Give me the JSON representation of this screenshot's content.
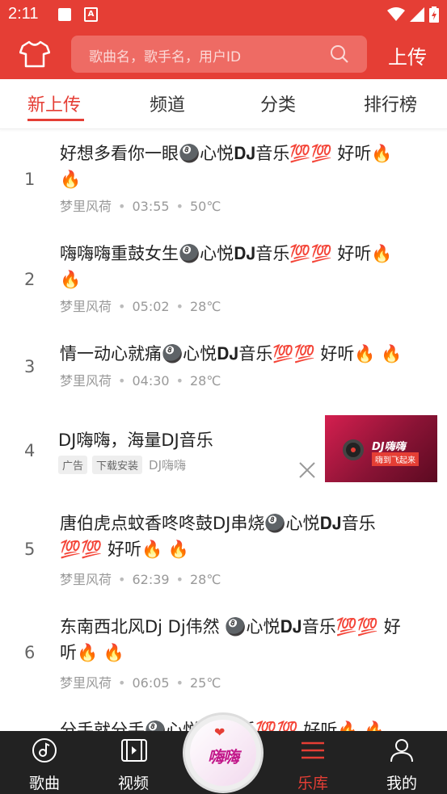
{
  "status_bar": {
    "time": "2:11",
    "icon_a": "A"
  },
  "header": {
    "search_placeholder": "歌曲名，歌手名，用户ID",
    "upload_label": "上传",
    "icons": [
      "shirt-icon",
      "search-icon"
    ]
  },
  "tabs": [
    {
      "label": "新上传",
      "active": true
    },
    {
      "label": "频道",
      "active": false
    },
    {
      "label": "分类",
      "active": false
    },
    {
      "label": "排行榜",
      "active": false
    }
  ],
  "songs": [
    {
      "index": "1",
      "title_line1": "好想多看你一眼🎱心悦𝐃𝐉音乐💯💯 好听🔥",
      "title_line2": "🔥",
      "artist": "梦里风荷",
      "duration": "03:55",
      "temp": "50℃"
    },
    {
      "index": "2",
      "title_line1": "嗨嗨嗨重鼓女生🎱心悦𝐃𝐉音乐💯💯 好听🔥",
      "title_line2": "🔥",
      "artist": "梦里风荷",
      "duration": "05:02",
      "temp": "28℃"
    },
    {
      "index": "3",
      "title_line1": "情一动心就痛🎱心悦𝐃𝐉音乐💯💯 好听🔥 🔥",
      "title_line2": "",
      "artist": "梦里风荷",
      "duration": "04:30",
      "temp": "28℃"
    },
    {
      "index": "5",
      "title_line1": "唐伯虎点蚊香咚咚鼓DJ串烧🎱心悦𝐃𝐉音乐",
      "title_line2": "💯💯 好听🔥 🔥",
      "artist": "梦里风荷",
      "duration": "62:39",
      "temp": "28℃"
    },
    {
      "index": "6",
      "title_line1": "东南西北风Dj Dj伟然 🎱心悦𝐃𝐉音乐💯💯 好",
      "title_line2": "听🔥 🔥",
      "artist": "梦里风荷",
      "duration": "06:05",
      "temp": "25℃"
    },
    {
      "index": "",
      "title_line1": "分手就分手🎱心悦𝐃𝐉音乐💯💯 好听🔥 🔥",
      "title_line2": "",
      "artist": "",
      "duration": "",
      "temp": ""
    }
  ],
  "ad": {
    "index": "4",
    "title": "DJ嗨嗨，海量DJ音乐",
    "tag_ad": "广告",
    "tag_download": "下载安装",
    "source": "DJ嗨嗨",
    "image_title": "DJ嗨嗨",
    "image_subtitle": "嗨到飞起来"
  },
  "bottom_nav": [
    {
      "label": "歌曲",
      "icon": "music-disc-icon",
      "active": false
    },
    {
      "label": "视频",
      "icon": "video-icon",
      "active": false
    },
    {
      "label": "乐库",
      "icon": "library-menu-icon",
      "active": true
    },
    {
      "label": "我的",
      "icon": "person-icon",
      "active": false
    }
  ],
  "center_button": {
    "text": "嗨嗨"
  },
  "colors": {
    "accent": "#e53e35",
    "nav_bg": "#222222"
  }
}
